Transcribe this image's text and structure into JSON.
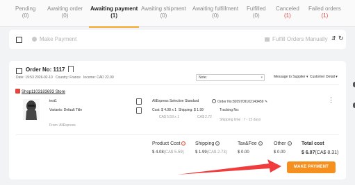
{
  "tabs": [
    {
      "label": "Pending",
      "count": "(0)",
      "count_color": "muted"
    },
    {
      "label": "Awaiting order",
      "count": "(0)",
      "count_color": "muted"
    },
    {
      "label": "Awaiting payment",
      "count": "(1)",
      "count_color": "dark",
      "active": true
    },
    {
      "label": "Awaiting shipment",
      "count": "(0)",
      "count_color": "muted"
    },
    {
      "label": "Awaiting fulfillment",
      "count": "(0)",
      "count_color": "muted"
    },
    {
      "label": "Fulfilled",
      "count": "(0)",
      "count_color": "muted"
    },
    {
      "label": "Canceled",
      "count": "(1)",
      "count_color": "red"
    },
    {
      "label": "Failed orders",
      "count": "(1)",
      "count_color": "red"
    }
  ],
  "toolbar": {
    "make_payment": "Make Payment",
    "fulfill_orders": "Fulfill Orders Manually"
  },
  "order": {
    "number_label": "Order No: 1117",
    "date": "Date: 19:53 2026-02-10",
    "country": "Country: France",
    "income": "Income: CAD 22.00",
    "note_placeholder": "Note:",
    "message_supplier": "Message to Supplier",
    "customer_detail": "Customer Detail",
    "store": "Shop1103183693 Store",
    "product_name": "test1",
    "variant": "Variants: Default Title",
    "from": "From: AliExpress",
    "shipping_method": "AliExpress Selection Standard",
    "cost": "Cost:  $ 4.08 x 1",
    "shipping": "Shipping:  $ 1.99",
    "cost_cad": "CA$ 5.59 x 1",
    "shipping_cad": "CA$ 2.72",
    "supplier_order_no": "Order No:8209709102143459",
    "tracking": "Tracking No:",
    "shipping_time": "Shipping time : 7 - 15 days"
  },
  "summary": {
    "product_cost_label": "Product Cost",
    "product_cost": "$ 4.08",
    "product_cost_cad": "(CA$ 5.59)",
    "shipping_label": "Shipping",
    "shipping": "$ 1.99",
    "shipping_cad": "(CA$ 2.73)",
    "tax_label": "Tax&Fee",
    "tax": "$ 0.00",
    "other_label": "Other",
    "other": "$ 0.00",
    "total_label": "Total cost",
    "total": "$ 6.07",
    "total_cad": "(CA$ 8.31)"
  },
  "make_payment_button": "MAKE PAYMENT",
  "colors": {
    "accent": "#f5901e",
    "active_tab": "#f5a623",
    "arrow": "#f03c3c",
    "alert": "#e2463c"
  }
}
